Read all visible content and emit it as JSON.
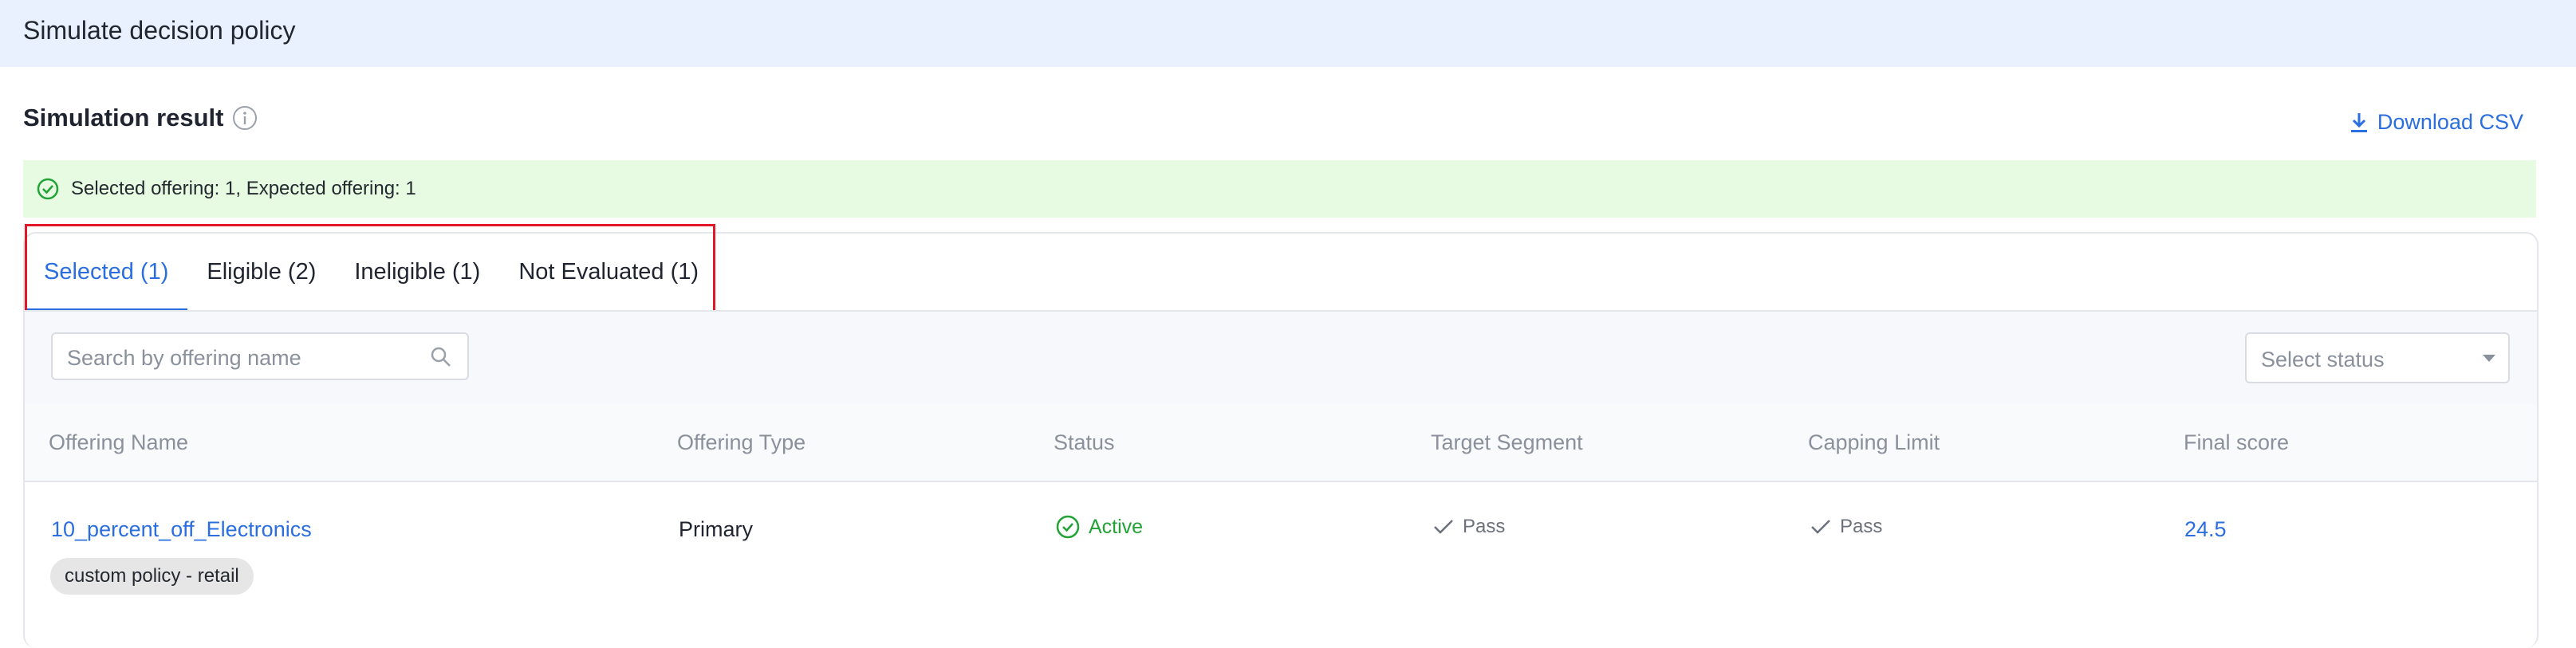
{
  "header": {
    "title": "Simulate decision policy"
  },
  "result": {
    "title": "Simulation result",
    "download_label": "Download CSV",
    "banner_text": "Selected offering: 1, Expected offering: 1"
  },
  "tabs": [
    {
      "label": "Selected (1)",
      "active": true
    },
    {
      "label": "Eligible (2)",
      "active": false
    },
    {
      "label": "Ineligible (1)",
      "active": false
    },
    {
      "label": "Not Evaluated (1)",
      "active": false
    }
  ],
  "search": {
    "placeholder": "Search by offering name",
    "value": ""
  },
  "status_filter": {
    "placeholder": "Select status"
  },
  "table": {
    "columns": [
      "Offering Name",
      "Offering Type",
      "Status",
      "Target Segment",
      "Capping Limit",
      "Final score"
    ],
    "rows": [
      {
        "offering_name": "10_percent_off_Electronics",
        "tag": "custom policy - retail",
        "offering_type": "Primary",
        "status": "Active",
        "target_segment": "Pass",
        "capping_limit": "Pass",
        "final_score": "24.5"
      }
    ]
  },
  "colors": {
    "accent": "#2a6ee0",
    "success": "#21a336",
    "banner_bg": "#e6fbe2",
    "topbar_bg": "#e8f1fd",
    "highlight": "#e0182a"
  },
  "icons": {
    "info": "info-icon",
    "download": "download-icon",
    "banner": "check-circle-icon",
    "search": "search-icon",
    "status": "check-circle-icon",
    "pass": "check-icon"
  }
}
